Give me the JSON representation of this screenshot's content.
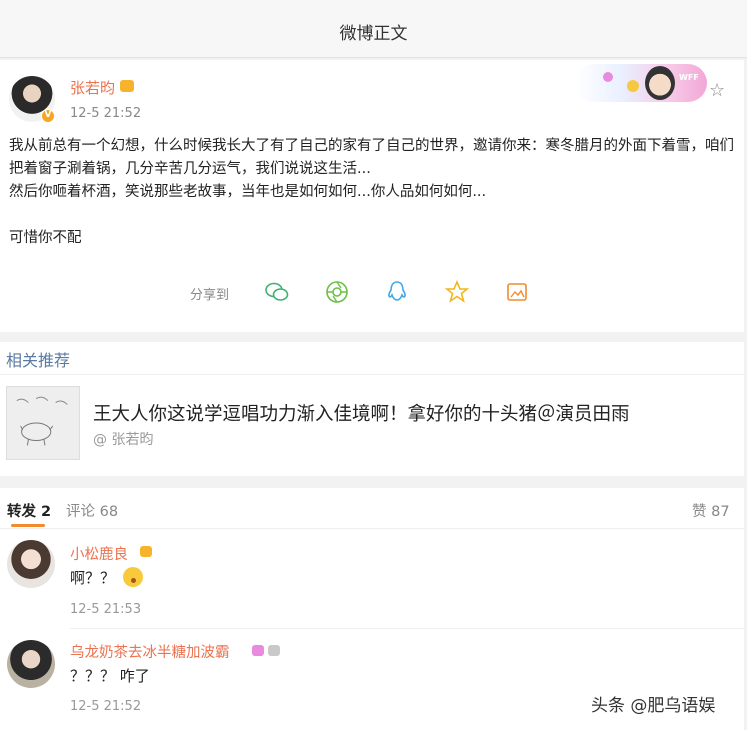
{
  "header": {
    "title": "微博正文"
  },
  "post": {
    "author": "张若昀",
    "time": "12-5 21:52",
    "banner_tag": "WFF",
    "lines": [
      "我从前总有一个幻想，什么时候我长大了有了自己的家有了自己的世界，邀请你来：寒冬腊月的外面下着雪，咱们把着窗子涮着锅，几分辛苦几分运气，我们说说这生活...",
      "然后你咂着杯酒，笑说那些老故事，当年也是如何如何...你人品如何如何...",
      "",
      "可惜你不配"
    ],
    "share_label": "分享到",
    "share_icons": [
      "wechat-icon",
      "moments-icon",
      "qq-icon",
      "qzone-icon",
      "save-image-icon"
    ]
  },
  "related": {
    "title": "相关推荐",
    "item": {
      "headline": "王大人你这说学逗唱功力渐入佳境啊！拿好你的十头猪＠演员田雨",
      "source": "@ 张若昀"
    }
  },
  "comments": {
    "tabs": {
      "repost": "转发 2",
      "comment": "评论 68",
      "like": "赞 87"
    },
    "items": [
      {
        "name": "小松鹿良",
        "text": "啊？？",
        "time": "12-5 21:53"
      },
      {
        "name": "乌龙奶茶去冰半糖加波霸",
        "text": "？？？ 咋了",
        "time": "12-5 21:52"
      }
    ]
  },
  "watermark": "头条 @肥乌语娱",
  "colors": {
    "author": "#eb7350",
    "link": "#5b7aa3",
    "accent": "#f28a30"
  }
}
